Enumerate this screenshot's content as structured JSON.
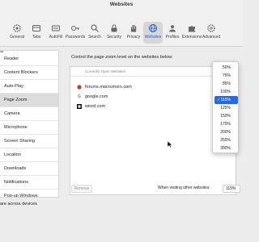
{
  "window": {
    "title": "Websites"
  },
  "toolbar": {
    "items": [
      {
        "label": "General",
        "icon": "gear-icon"
      },
      {
        "label": "Tabs",
        "icon": "tabs-icon"
      },
      {
        "label": "AutoFill",
        "icon": "autofill-icon"
      },
      {
        "label": "Passwords",
        "icon": "key-icon"
      },
      {
        "label": "Search",
        "icon": "search-icon"
      },
      {
        "label": "Security",
        "icon": "lock-icon"
      },
      {
        "label": "Privacy",
        "icon": "hand-icon"
      },
      {
        "label": "Websites",
        "icon": "globe-icon"
      },
      {
        "label": "Profiles",
        "icon": "profile-icon"
      },
      {
        "label": "Extensions",
        "icon": "puzzle-icon"
      },
      {
        "label": "Advanced",
        "icon": "advanced-gear-icon"
      }
    ],
    "selected": "Websites",
    "accent_color": "#1b62d6"
  },
  "sidebar": {
    "clipped_label": "al",
    "items": [
      {
        "label": "Reader"
      },
      {
        "label": "Content Blockers"
      },
      {
        "label": "Auto-Play"
      },
      {
        "label": "Page Zoom"
      },
      {
        "label": "Camera"
      },
      {
        "label": "Microphone"
      },
      {
        "label": "Screen Sharing"
      },
      {
        "label": "Location"
      },
      {
        "label": "Downloads"
      },
      {
        "label": "Notifications"
      },
      {
        "label": "Pop-up Windows"
      }
    ],
    "selected": "Page Zoom"
  },
  "share_text": "are across devices",
  "panel": {
    "description": "Control the page zoom level on the websites below:",
    "sites_header": "Currently Open Websites",
    "sites": [
      {
        "name": "forums.macrumors.com",
        "icon": "macrumors-favicon"
      },
      {
        "name": "google.com",
        "icon": "google-favicon"
      },
      {
        "name": "wired.com",
        "icon": "wired-favicon"
      }
    ],
    "remove_label": "Remove",
    "other_label": "When visiting other websites:",
    "other_value": "115%"
  },
  "zoom_dropdown": {
    "options": [
      "50%",
      "75%",
      "85%",
      "100%",
      "115%",
      "125%",
      "150%",
      "175%",
      "200%",
      "250%",
      "300%"
    ],
    "selected": "115%",
    "selected_color": "#2a6ae0"
  }
}
